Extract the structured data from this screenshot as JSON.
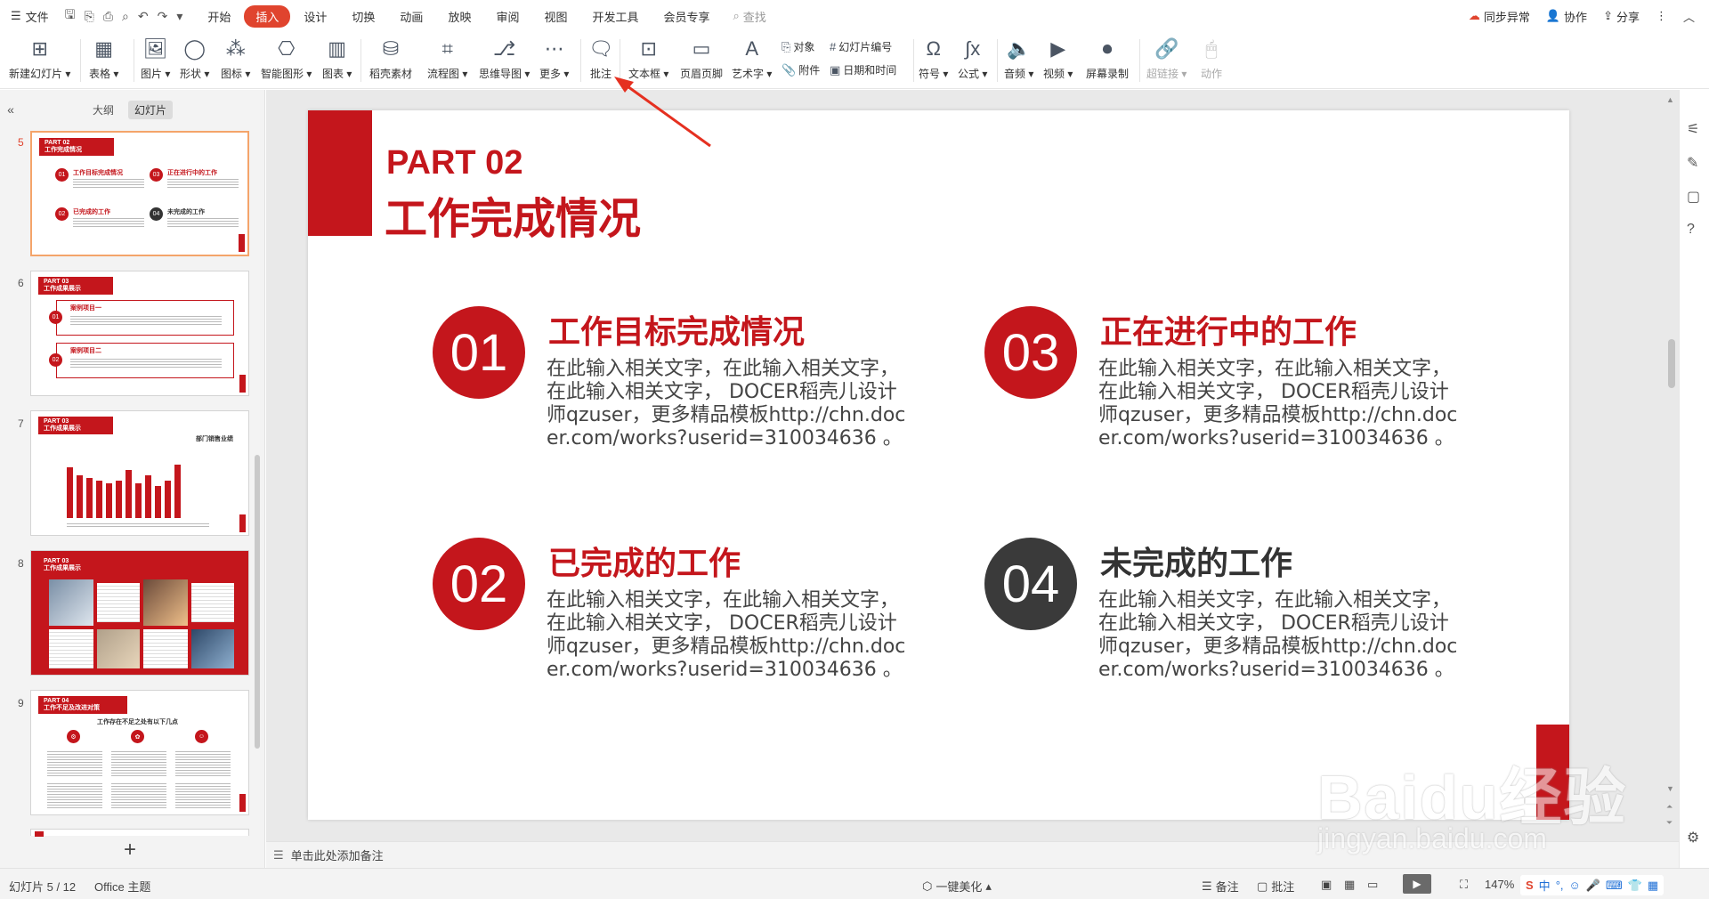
{
  "menubar": {
    "file_label": "文件",
    "tabs": [
      "开始",
      "插入",
      "设计",
      "切换",
      "动画",
      "放映",
      "审阅",
      "视图",
      "开发工具",
      "会员专享"
    ],
    "active_tab": "插入",
    "search_label": "查找",
    "sync_label": "同步异常",
    "collab_label": "协作",
    "share_label": "分享"
  },
  "ribbon": {
    "new_slide": "新建幻灯片",
    "table": "表格",
    "picture": "图片",
    "shape": "形状",
    "icon": "图标",
    "smart_art": "智能图形",
    "chart": "图表",
    "docer": "稻壳素材",
    "flowchart": "流程图",
    "mindmap": "思维导图",
    "more": "更多",
    "comment": "批注",
    "textbox": "文本框",
    "header_footer": "页眉页脚",
    "wordart": "艺术字",
    "object": "对象",
    "slide_number": "幻灯片编号",
    "attachment": "附件",
    "datetime": "日期和时间",
    "symbol": "符号",
    "formula": "公式",
    "audio": "音频",
    "video": "视频",
    "screen_record": "屏幕录制",
    "hyperlink": "超链接",
    "action": "动作"
  },
  "left_panel": {
    "tab_outline": "大纲",
    "tab_slides": "幻灯片",
    "slide_numbers": [
      "5",
      "6",
      "7",
      "8",
      "9"
    ],
    "thumb5": {
      "part": "PART 02",
      "title": "工作完成情况",
      "items": [
        "工作目标完成情况",
        "正在进行中的工作",
        "已完成的工作",
        "未完成的工作"
      ]
    },
    "thumb6": {
      "part": "PART 03",
      "title": "工作成果展示",
      "items": [
        "案例项目一",
        "案例项目二"
      ]
    },
    "thumb7": {
      "part": "PART 03",
      "title": "工作成果展示",
      "chart_title": "部门销售业绩",
      "bar_values": [
        0.95,
        0.8,
        0.75,
        0.7,
        0.65,
        0.7,
        0.9,
        0.65,
        0.8,
        0.6,
        0.7,
        1.0
      ]
    },
    "thumb8": {
      "part": "PART 03",
      "title": "工作成果展示"
    },
    "thumb9": {
      "part": "PART 04",
      "title": "工作不足及改进对策",
      "subtitle": "工作存在不足之处有以下几点"
    }
  },
  "slide": {
    "part": "PART 02",
    "title": "工作完成情况",
    "items": [
      {
        "num": "01",
        "heading": "工作目标完成情况",
        "body": "在此输入相关文字，在此输入相关文字，在此输入相关文字， DOCER稻壳儿设计师qzuser，更多精品模板http://chn.docer.com/works?userid=310034636 。"
      },
      {
        "num": "03",
        "heading": "正在进行中的工作",
        "body": "在此输入相关文字，在此输入相关文字，在此输入相关文字， DOCER稻壳儿设计师qzuser，更多精品模板http://chn.docer.com/works?userid=310034636 。"
      },
      {
        "num": "02",
        "heading": "已完成的工作",
        "body": "在此输入相关文字，在此输入相关文字，在此输入相关文字， DOCER稻壳儿设计师qzuser，更多精品模板http://chn.docer.com/works?userid=310034636 。"
      },
      {
        "num": "04",
        "heading": "未完成的工作",
        "body": "在此输入相关文字，在此输入相关文字，在此输入相关文字， DOCER稻壳儿设计师qzuser，更多精品模板http://chn.docer.com/works?userid=310034636 。"
      }
    ]
  },
  "notes": {
    "placeholder": "单击此处添加备注"
  },
  "status": {
    "slide_count": "幻灯片 5 / 12",
    "theme": "Office 主题",
    "beautify": "一键美化",
    "notes": "备注",
    "comments": "批注",
    "zoom": "147%"
  },
  "ime": {
    "lang": "中"
  },
  "watermark": {
    "text": "Baidu经验",
    "sub": "jingyan.baidu.com"
  },
  "colors": {
    "brand_red": "#c4161c",
    "active_tab": "#e0442e",
    "dark_circle": "#3a3a3a"
  }
}
